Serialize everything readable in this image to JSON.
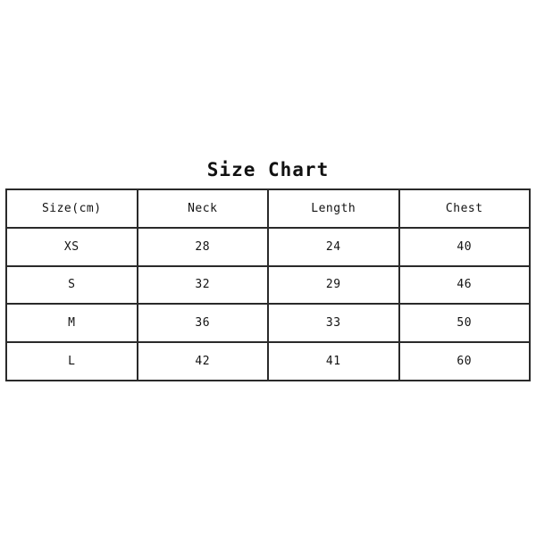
{
  "page": {
    "background_color": "#ffffff",
    "title_text": "Size Chart"
  },
  "table": {
    "border_color": "#2a2a2a",
    "text_color": "#131313",
    "headers": [
      "Size(cm)",
      "Neck",
      "Length",
      "Chest"
    ],
    "rows": [
      {
        "size": "XS",
        "neck": "28",
        "length": "24",
        "chest": "40"
      },
      {
        "size": "S",
        "neck": "32",
        "length": "29",
        "chest": "46"
      },
      {
        "size": "M",
        "neck": "36",
        "length": "33",
        "chest": "50"
      },
      {
        "size": "L",
        "neck": "42",
        "length": "41",
        "chest": "60"
      }
    ]
  },
  "chart_data": {
    "type": "table",
    "title": "Size Chart",
    "columns": [
      "Size(cm)",
      "Neck",
      "Length",
      "Chest"
    ],
    "units": "cm",
    "categories": [
      "XS",
      "S",
      "M",
      "L"
    ],
    "series": [
      {
        "name": "Neck",
        "values": [
          28,
          32,
          36,
          42
        ]
      },
      {
        "name": "Length",
        "values": [
          24,
          29,
          33,
          41
        ]
      },
      {
        "name": "Chest",
        "values": [
          40,
          46,
          50,
          60
        ]
      }
    ],
    "rows": [
      [
        "XS",
        28,
        24,
        40
      ],
      [
        "S",
        32,
        29,
        46
      ],
      [
        "M",
        36,
        33,
        50
      ],
      [
        "L",
        42,
        41,
        60
      ]
    ],
    "xlabel": "",
    "ylabel": "",
    "grid": true,
    "legend": "none"
  }
}
